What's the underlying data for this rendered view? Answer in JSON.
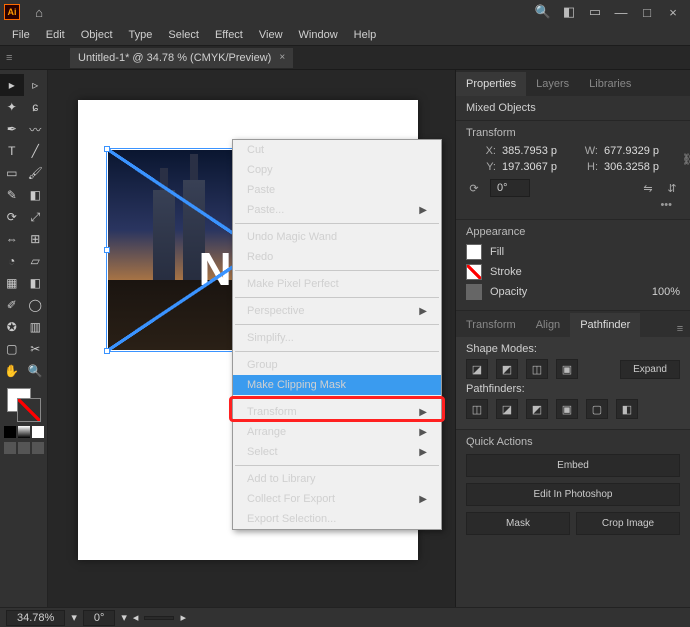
{
  "titlebar": {
    "logo": "Ai"
  },
  "menubar": [
    "File",
    "Edit",
    "Object",
    "Type",
    "Select",
    "Effect",
    "View",
    "Window",
    "Help"
  ],
  "doc": {
    "tab": "Untitled-1* @ 34.78 % (CMYK/Preview)",
    "close": "×"
  },
  "canvas": {
    "text": "NIGH"
  },
  "context_menu": {
    "items": [
      {
        "label": "Cut"
      },
      {
        "label": "Copy"
      },
      {
        "label": "Paste"
      },
      {
        "label": "Paste...",
        "sub": true
      },
      {
        "sep": true
      },
      {
        "label": "Undo Magic Wand"
      },
      {
        "label": "Redo",
        "disabled": true
      },
      {
        "sep": true
      },
      {
        "label": "Make Pixel Perfect"
      },
      {
        "sep": true
      },
      {
        "label": "Perspective",
        "sub": true,
        "disabled": true
      },
      {
        "sep": true
      },
      {
        "label": "Simplify...",
        "disabled": true
      },
      {
        "sep": true
      },
      {
        "label": "Group"
      },
      {
        "label": "Make Clipping Mask",
        "hl": true
      },
      {
        "sep": true
      },
      {
        "label": "Transform",
        "sub": true
      },
      {
        "label": "Arrange",
        "sub": true
      },
      {
        "label": "Select",
        "sub": true
      },
      {
        "sep": true
      },
      {
        "label": "Add to Library"
      },
      {
        "label": "Collect For Export",
        "sub": true
      },
      {
        "label": "Export Selection..."
      }
    ]
  },
  "panels": {
    "tabs": [
      "Properties",
      "Layers",
      "Libraries"
    ],
    "selection_title": "Mixed Objects",
    "transform": {
      "title": "Transform",
      "x_label": "X:",
      "x": "385.7953 p",
      "y_label": "Y:",
      "y": "197.3067 p",
      "w_label": "W:",
      "w": "677.9329 p",
      "h_label": "H:",
      "h": "306.3258 p",
      "rotate": "0°"
    },
    "appearance": {
      "title": "Appearance",
      "fill": "Fill",
      "stroke": "Stroke",
      "opacity_label": "Opacity",
      "opacity": "100%"
    },
    "pathfinder": {
      "tabs": [
        "Transform",
        "Align",
        "Pathfinder"
      ],
      "shape_modes": "Shape Modes:",
      "expand": "Expand",
      "pathfinders": "Pathfinders:"
    },
    "quick": {
      "title": "Quick Actions",
      "embed": "Embed",
      "edit": "Edit In Photoshop",
      "mask": "Mask",
      "crop": "Crop Image"
    }
  },
  "statusbar": {
    "zoom": "34.78%",
    "rotate": "0°"
  }
}
